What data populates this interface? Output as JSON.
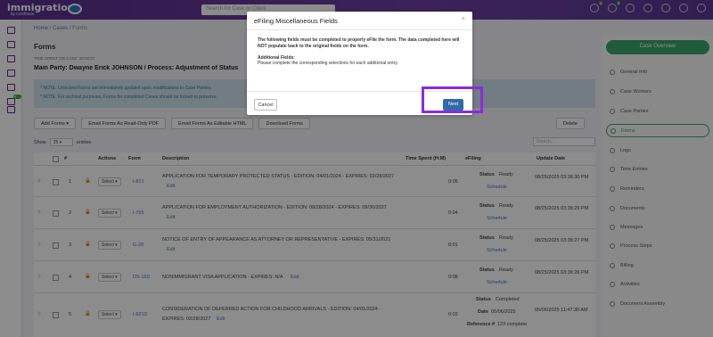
{
  "app": {
    "logo": "immigration",
    "logo_sub": "by corethode",
    "search_placeholder": "Search for Case or Client"
  },
  "topbar_badges": {
    "tasks": "3",
    "alerts": "9"
  },
  "leftnav_badge": "8",
  "breadcrumb": {
    "home": "Home",
    "sep1": " / ",
    "cases": "Cases",
    "sep2": " / ",
    "forms": "Forms"
  },
  "page": {
    "title": "Forms",
    "time_spent": "TIME SPENT ON CASE: 00:00:07",
    "party": "Main Party: Dwayne Erick JOHNSON / Process: Adjustment of Status"
  },
  "notes": [
    "* NOTE: Unlocked Forms are immediately updated upon modifications to Case Parties.",
    "* NOTE: For archival purposes, Forms for completed Cases should be locked to preserve."
  ],
  "toolbar": {
    "add_forms": "Add Forms ▾",
    "email_ro": "Email Forms As Read-Only PDF",
    "email_edit": "Email Forms As Editable HTML",
    "download": "Download Forms",
    "delete": "Delete"
  },
  "table_controls": {
    "show": "Show",
    "entries_value": "25 ▾",
    "entries": "entries",
    "search_placeholder": "Search..."
  },
  "columns": {
    "num": "#",
    "actions": "Actions",
    "form": "Form",
    "description": "Description",
    "time": "Time Spent (H:M)",
    "efiling": "eFiling",
    "update": "Update Date"
  },
  "rows": [
    {
      "num": "1",
      "select": "Select ▾",
      "form": "I-821",
      "desc": "APPLICATION FOR TEMPORARY PROTECTED STATUS - EDITION: 04/01/2024 - EXPIRES: 02/28/2027",
      "edit": "Edit",
      "time": "0:05",
      "status_label": "Status",
      "status": "Ready",
      "schedule": "Schedule",
      "date": "08/25/2025 03:36:30 PM"
    },
    {
      "num": "2",
      "select": "Select ▾",
      "form": "I-765",
      "desc": "APPLICATION FOR EMPLOYMENT AUTHORIZATION - EDITION: 08/28/2024 - EXPIRES: 09/30/2027",
      "edit": "Edit",
      "time": "0:04",
      "status_label": "Status",
      "status": "Ready",
      "schedule": "Schedule",
      "date": "08/25/2025 03:36:29 PM"
    },
    {
      "num": "3",
      "select": "Select ▾",
      "form": "G-28",
      "desc": "NOTICE OF ENTRY OF APPEARANCE AS ATTORNEY OR REPRESENTATIVE - EXPIRES: 05/31/2021",
      "edit": "Edit",
      "time": "0:01",
      "status_label": "Status",
      "status": "Ready",
      "schedule": "Schedule",
      "date": "08/25/2025 03:36:27 PM"
    },
    {
      "num": "4",
      "select": "Select ▾",
      "form": "DS-160",
      "desc": "NONIMMIGRANT VISA APPLICATION - EXPIRES: N/A",
      "edit": "Edit",
      "time": "0:08",
      "status_label": "Status",
      "status": "Ready",
      "schedule": "Schedule",
      "date": "08/25/2025 03:36:26 PM"
    },
    {
      "num": "5",
      "select": "Select ▾",
      "form": "I-821D",
      "desc": "CONSIDERATION OF DEFERRED ACTION FOR CHILDHOOD ARRIVALS - EDITION: 04/01/2024 -",
      "desc2": "EXPIRES: 02/28/2027",
      "edit": "Edit",
      "time": "0:03",
      "status_label": "Status",
      "status": "Completed",
      "date_label": "Date",
      "date_val": "05/06/2025",
      "ref_label": "Reference #",
      "ref_val": "123 complete",
      "date": "05/06/2025 11:47:30 AM"
    }
  ],
  "sidebar": {
    "case_overview": "Case Overview",
    "items": [
      "General Info",
      "Case Workers",
      "Case Parties",
      "Forms",
      "Logs",
      "Time Entries",
      "Reminders",
      "Documents",
      "Messages",
      "Process Steps",
      "Billing",
      "Activities",
      "Document Assembly"
    ]
  },
  "modal": {
    "title": "eFiling Miscellaneous Fields",
    "close": "×",
    "warning": "The following fields must be completed to properly eFile the form. The data completed here will NOT populate back to the original fields on the form.",
    "additional_title": "Additional Fields:",
    "additional_text": "Please complete the corresponding selections for each additional entry.",
    "cancel": "Cancel",
    "next": "Next"
  },
  "colors": {
    "brand": "#5b2f8f",
    "accent_green": "#3aa76d",
    "primary_button": "#2f6aa8",
    "highlight": "#8a2be2"
  }
}
